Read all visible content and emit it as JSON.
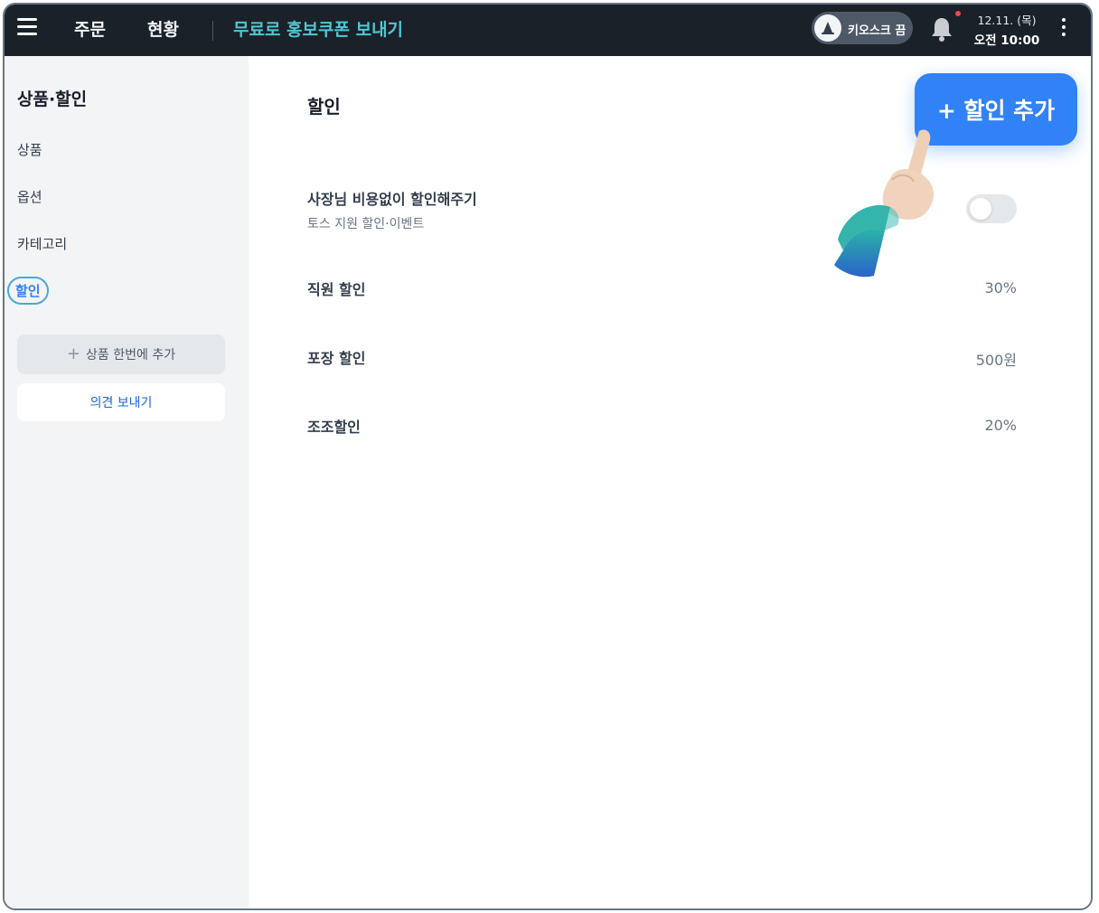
{
  "topbar": {
    "nav": {
      "order": "주문",
      "status": "현황",
      "coupon": "무료로 홍보쿠폰 보내기"
    },
    "kiosk_label": "키오스크 끔",
    "clock": {
      "date": "12.11. (목)",
      "time": "오전 10:00"
    }
  },
  "sidebar": {
    "title": "상품·할인",
    "items": [
      {
        "label": "상품"
      },
      {
        "label": "옵션"
      },
      {
        "label": "카테고리"
      },
      {
        "label": "할인",
        "active": true
      }
    ],
    "bulk_add_label": "상품 한번에 추가",
    "feedback_label": "의견 보내기"
  },
  "main": {
    "title": "할인",
    "add_button_label": "+ 할인 추가",
    "discounts": [
      {
        "name": "사장님 비용없이 할인해주기",
        "sub": "토스 지원 할인·이벤트",
        "toggle": false
      },
      {
        "name": "직원 할인",
        "value": "30%"
      },
      {
        "name": "포장 할인",
        "value": "500원"
      },
      {
        "name": "조조할인",
        "value": "20%"
      }
    ]
  },
  "colors": {
    "topbar_bg": "#1b2129",
    "accent_blue": "#3182f6",
    "coupon_teal": "#4fc7d1",
    "sidebar_bg": "#f2f4f6",
    "notification_dot": "#f04452"
  }
}
